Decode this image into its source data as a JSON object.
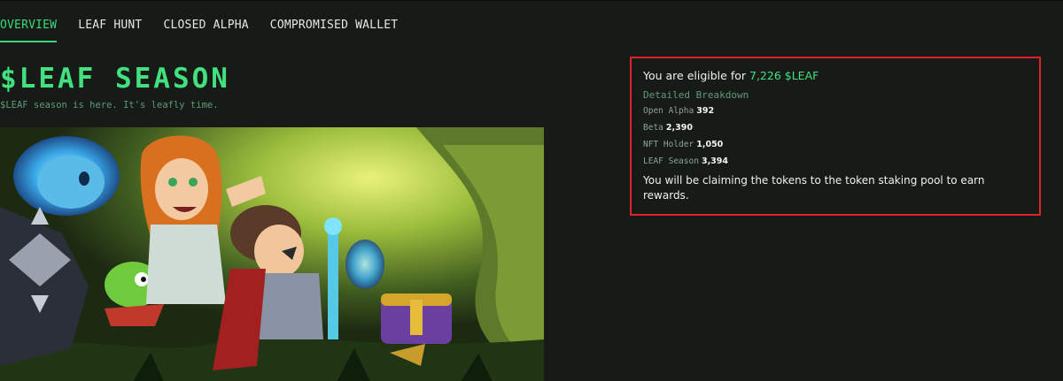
{
  "nav": {
    "tabs": [
      {
        "label": "OVERVIEW",
        "active": true
      },
      {
        "label": "LEAF HUNT",
        "active": false
      },
      {
        "label": "CLOSED ALPHA",
        "active": false
      },
      {
        "label": "COMPROMISED WALLET",
        "active": false
      }
    ]
  },
  "hero": {
    "title": "$LEAF SEASON",
    "subtitle": "$LEAF season is here. It's leafly time."
  },
  "eligibility": {
    "prefix": "You are eligible for",
    "amount": "7,226 $LEAF",
    "breakdown_title": "Detailed Breakdown",
    "breakdown": [
      {
        "label": "Open Alpha",
        "value": "392"
      },
      {
        "label": "Beta",
        "value": "2,390"
      },
      {
        "label": "NFT Holder",
        "value": "1,050"
      },
      {
        "label": "LEAF Season",
        "value": "3,394"
      }
    ],
    "note": "You will be claiming the tokens to the token staking pool to earn rewards."
  },
  "colors": {
    "background": "#171b17",
    "accent": "#42e07f",
    "muted": "#5e9b78",
    "highlight_border": "#e0232a"
  }
}
